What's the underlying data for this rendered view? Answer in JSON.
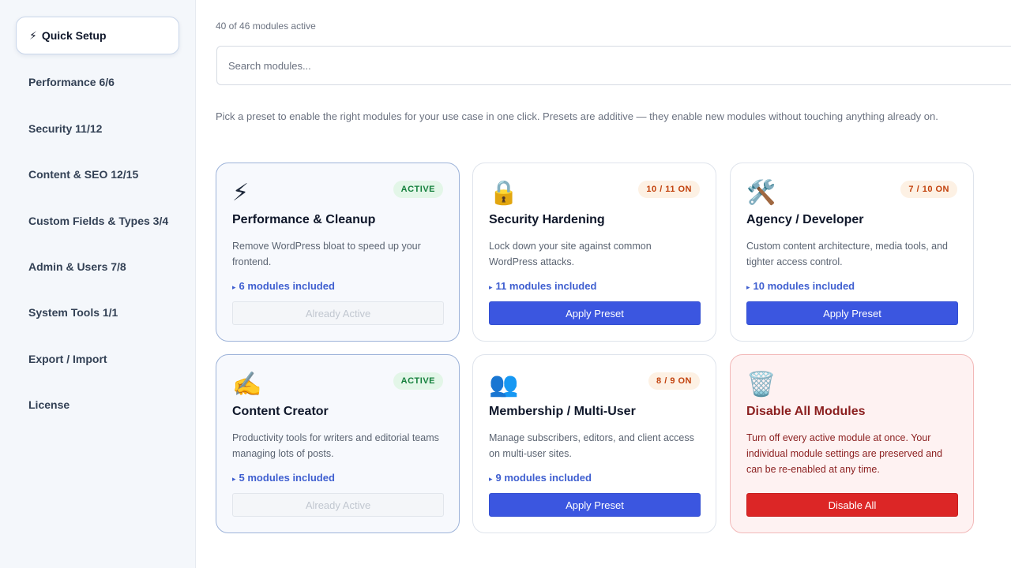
{
  "sidebar": {
    "items": [
      {
        "icon": "⚡",
        "label": "Quick Setup",
        "active": true
      },
      {
        "label": "Performance 6/6"
      },
      {
        "label": "Security 11/12"
      },
      {
        "label": "Content & SEO 12/15"
      },
      {
        "label": "Custom Fields & Types 3/4"
      },
      {
        "label": "Admin & Users 7/8"
      },
      {
        "label": "System Tools 1/1"
      },
      {
        "label": "Export / Import"
      },
      {
        "label": "License"
      }
    ]
  },
  "header": {
    "count": "40 of 46 modules active",
    "search_placeholder": "Search modules..."
  },
  "intro": "Pick a preset to enable the right modules for your use case in one click. Presets are additive — they enable new modules without touching anything already on.",
  "presets": [
    {
      "icon": "⚡",
      "icon_name": "lightning-icon",
      "badge": "ACTIVE",
      "title": "Performance & Cleanup",
      "desc": "Remove WordPress bloat to speed up your frontend.",
      "included": "6 modules included",
      "button": "Already Active"
    },
    {
      "icon": "🔒",
      "icon_name": "lock-icon",
      "badge": "10 / 11 ON",
      "title": "Security Hardening",
      "desc": "Lock down your site against common WordPress attacks.",
      "included": "11 modules included",
      "button": "Apply Preset"
    },
    {
      "icon": "🛠️",
      "icon_name": "tools-icon",
      "badge": "7 / 10 ON",
      "title": "Agency / Developer",
      "desc": "Custom content architecture, media tools, and tighter access control.",
      "included": "10 modules included",
      "button": "Apply Preset"
    },
    {
      "icon": "✍️",
      "icon_name": "writing-hand-icon",
      "badge": "ACTIVE",
      "title": "Content Creator",
      "desc": "Productivity tools for writers and editorial teams managing lots of posts.",
      "included": "5 modules included",
      "button": "Already Active"
    },
    {
      "icon": "👥",
      "icon_name": "users-icon",
      "badge": "8 / 9 ON",
      "title": "Membership / Multi-User",
      "desc": "Manage subscribers, editors, and client access on multi-user sites.",
      "included": "9 modules included",
      "button": "Apply Preset"
    },
    {
      "icon": "🗑️",
      "icon_name": "trash-icon",
      "title": "Disable All Modules",
      "desc": "Turn off every active module at once. Your individual module settings are preserved and can be re-enabled at any time.",
      "button": "Disable All"
    }
  ],
  "colors": {
    "primary": "#3b56e0",
    "danger": "#dc2626",
    "active_badge": "#15803d",
    "partial_badge": "#c2410c"
  }
}
